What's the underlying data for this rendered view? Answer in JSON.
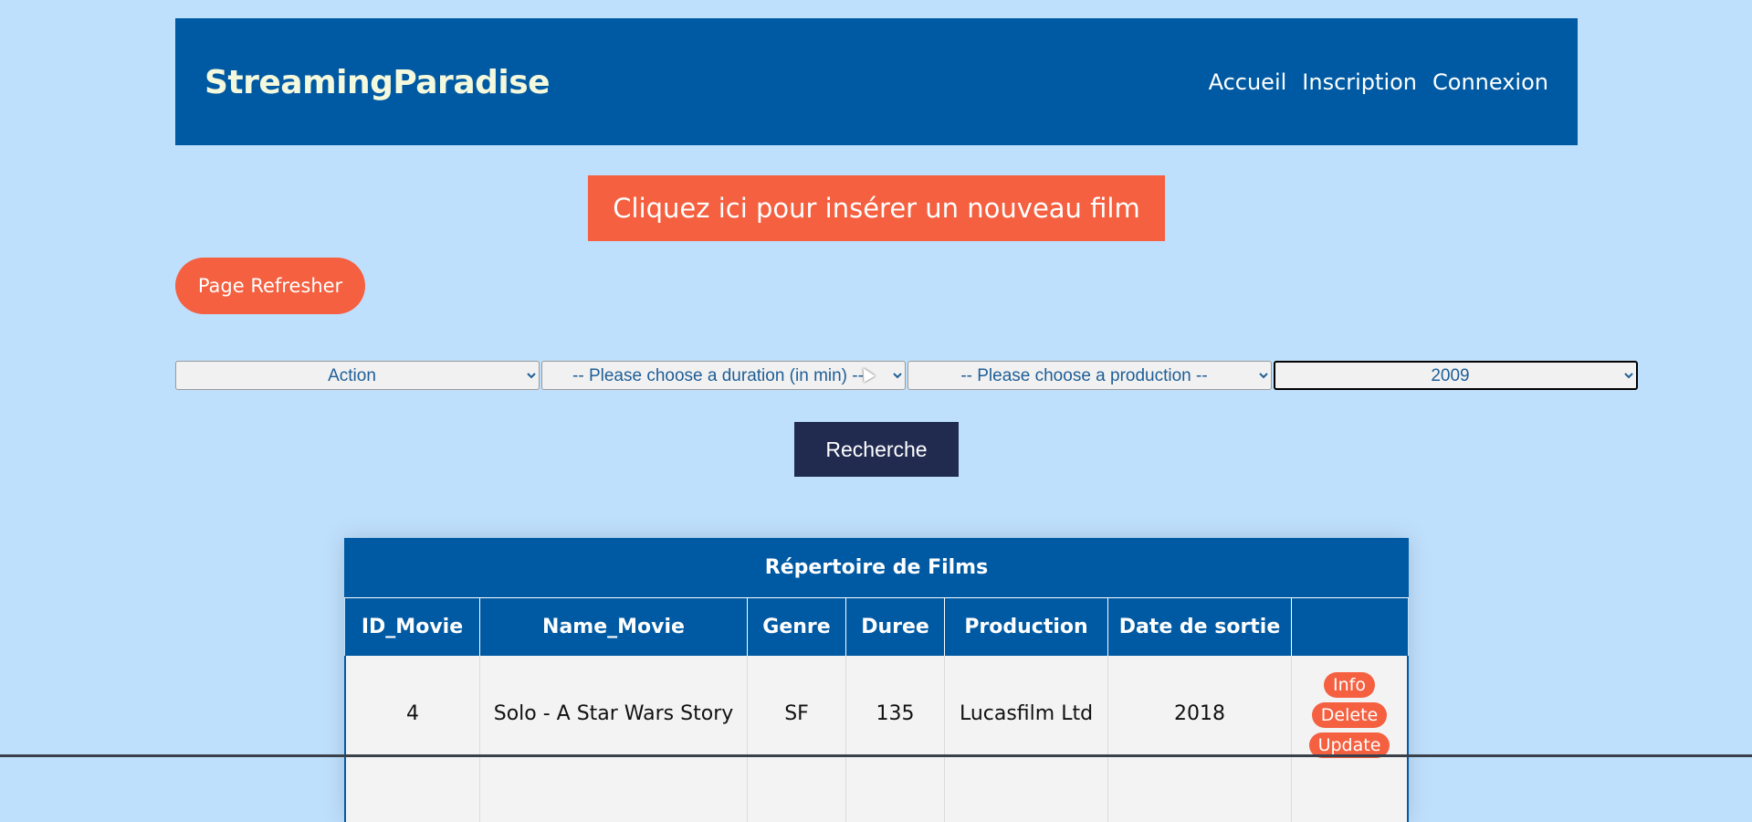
{
  "header": {
    "brand": "StreamingParadise",
    "nav": [
      "Accueil",
      "Inscription",
      "Connexion"
    ]
  },
  "actions": {
    "insert_label": "Cliquez ici pour insérer un nouveau film",
    "refresh_label": "Page Refresher",
    "search_label": "Recherche"
  },
  "filters": {
    "genre": "Action",
    "duration": "-- Please choose a duration (in min) --",
    "production": "-- Please choose a production --",
    "year": "2009"
  },
  "table": {
    "caption": "Répertoire de Films",
    "columns": [
      "ID_Movie",
      "Name_Movie",
      "Genre",
      "Duree",
      "Production",
      "Date de sortie",
      ""
    ],
    "rows": [
      {
        "id": "4",
        "name": "Solo - A Star Wars Story",
        "genre": "SF",
        "duree": "135",
        "production": "Lucasfilm Ltd",
        "date": "2018",
        "buttons": [
          "Info",
          "Delete",
          "Update"
        ]
      }
    ]
  },
  "colors": {
    "background": "#bfe0fd",
    "primary": "#005aa3",
    "accent": "#f46040",
    "dark_button": "#212b50"
  }
}
